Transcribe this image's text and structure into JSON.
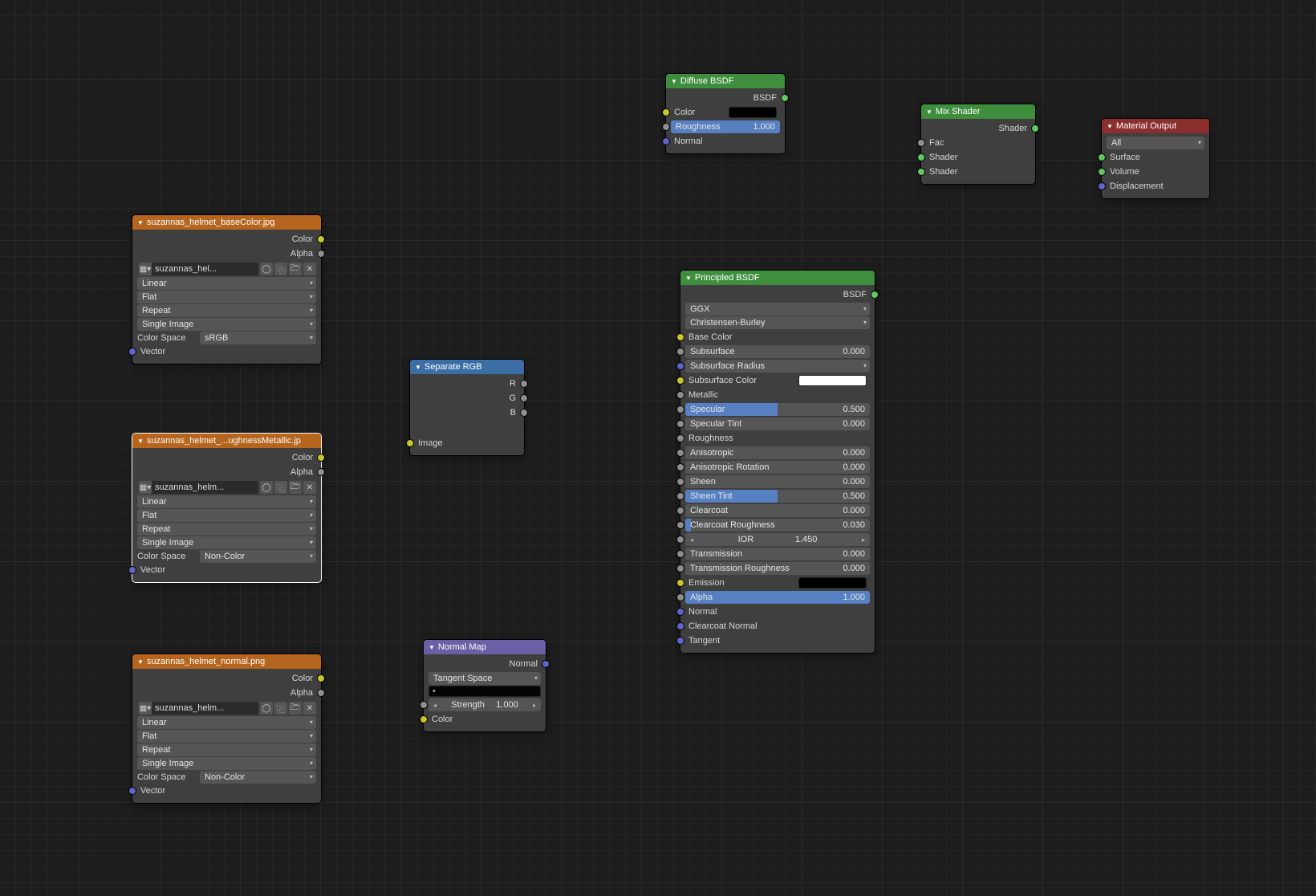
{
  "images": {
    "base": {
      "title": "suzannas_helmet_baseColor.jpg",
      "name": "suzannas_hel...",
      "interp": "Linear",
      "projection": "Flat",
      "extension": "Repeat",
      "source": "Single Image",
      "colorspace_lbl": "Color Space",
      "colorspace": "sRGB",
      "out_color": "Color",
      "out_alpha": "Alpha",
      "in_vector": "Vector"
    },
    "rough": {
      "title": "suzannas_helmet_...ughnessMetallic.jp",
      "name": "suzannas_helm...",
      "interp": "Linear",
      "projection": "Flat",
      "extension": "Repeat",
      "source": "Single Image",
      "colorspace_lbl": "Color Space",
      "colorspace": "Non-Color",
      "out_color": "Color",
      "out_alpha": "Alpha",
      "in_vector": "Vector"
    },
    "normal": {
      "title": "suzannas_helmet_normal.png",
      "name": "suzannas_helm...",
      "interp": "Linear",
      "projection": "Flat",
      "extension": "Repeat",
      "source": "Single Image",
      "colorspace_lbl": "Color Space",
      "colorspace": "Non-Color",
      "out_color": "Color",
      "out_alpha": "Alpha",
      "in_vector": "Vector"
    }
  },
  "separateRGB": {
    "title": "Separate RGB",
    "r": "R",
    "g": "G",
    "b": "B",
    "in_image": "Image"
  },
  "normalMap": {
    "title": "Normal Map",
    "out_normal": "Normal",
    "space": "Tangent Space",
    "strength_lbl": "Strength",
    "strength_val": "1.000",
    "in_color": "Color"
  },
  "diffuse": {
    "title": "Diffuse BSDF",
    "out": "BSDF",
    "color": "Color",
    "roughness_lbl": "Roughness",
    "roughness_val": "1.000",
    "normal": "Normal"
  },
  "principled": {
    "title": "Principled BSDF",
    "out": "BSDF",
    "dist": "GGX",
    "sss": "Christensen-Burley",
    "rows": [
      {
        "label": "Base Color",
        "sock": "yellow"
      },
      {
        "label": "Subsurface",
        "val": "0.000",
        "sock": "grey",
        "pct": 0
      },
      {
        "label": "Subsurface Radius",
        "sock": "purple",
        "drop": true
      },
      {
        "label": "Subsurface Color",
        "swatch": "white",
        "sock": "yellow"
      },
      {
        "label": "Metallic",
        "sock": "grey",
        "plain": true
      },
      {
        "label": "Specular",
        "val": "0.500",
        "sock": "grey",
        "pct": 50
      },
      {
        "label": "Specular Tint",
        "val": "0.000",
        "sock": "grey",
        "pct": 0
      },
      {
        "label": "Roughness",
        "sock": "grey",
        "plain": true
      },
      {
        "label": "Anisotropic",
        "val": "0.000",
        "sock": "grey",
        "pct": 0
      },
      {
        "label": "Anisotropic Rotation",
        "val": "0.000",
        "sock": "grey",
        "pct": 0
      },
      {
        "label": "Sheen",
        "val": "0.000",
        "sock": "grey",
        "pct": 0
      },
      {
        "label": "Sheen Tint",
        "val": "0.500",
        "sock": "grey",
        "pct": 50
      },
      {
        "label": "Clearcoat",
        "val": "0.000",
        "sock": "grey",
        "pct": 0
      },
      {
        "label": "Clearcoat Roughness",
        "val": "0.030",
        "sock": "grey",
        "pct": 3
      },
      {
        "label": "IOR",
        "val": "1.450",
        "sock": "grey",
        "pct": 0,
        "num": true
      },
      {
        "label": "Transmission",
        "val": "0.000",
        "sock": "grey",
        "pct": 0
      },
      {
        "label": "Transmission Roughness",
        "val": "0.000",
        "sock": "grey",
        "pct": 0
      },
      {
        "label": "Emission",
        "swatch": "black",
        "sock": "yellow"
      },
      {
        "label": "Alpha",
        "val": "1.000",
        "sock": "grey",
        "pct": 100
      },
      {
        "label": "Normal",
        "sock": "purple",
        "plain": true
      },
      {
        "label": "Clearcoat Normal",
        "sock": "purple",
        "plain": true
      },
      {
        "label": "Tangent",
        "sock": "purple",
        "plain": true
      }
    ]
  },
  "mix": {
    "title": "Mix Shader",
    "out": "Shader",
    "fac": "Fac",
    "s1": "Shader",
    "s2": "Shader"
  },
  "output": {
    "title": "Material Output",
    "target": "All",
    "surface": "Surface",
    "volume": "Volume",
    "displacement": "Displacement"
  }
}
